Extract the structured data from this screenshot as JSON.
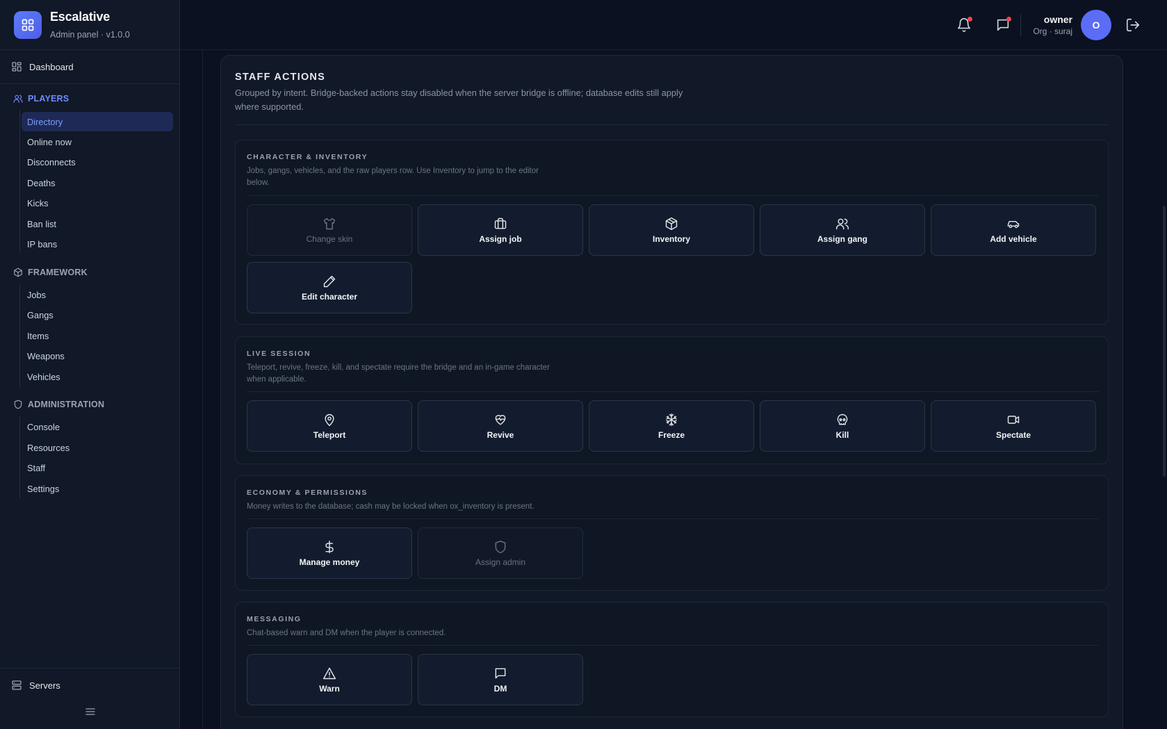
{
  "app": {
    "name": "Escalative",
    "subtitle": "Admin panel · v1.0.0"
  },
  "sidebar": {
    "dashboard": "Dashboard",
    "sections": [
      {
        "title": "PLAYERS",
        "items": [
          "Directory",
          "Online now",
          "Disconnects",
          "Deaths",
          "Kicks",
          "Ban list",
          "IP bans"
        ]
      },
      {
        "title": "FRAMEWORK",
        "items": [
          "Jobs",
          "Gangs",
          "Items",
          "Weapons",
          "Vehicles"
        ]
      },
      {
        "title": "ADMINISTRATION",
        "items": [
          "Console",
          "Resources",
          "Staff",
          "Settings"
        ]
      }
    ],
    "active_item": "Directory",
    "servers": "Servers"
  },
  "topbar": {
    "user_name": "owner",
    "user_org": "Org · suraj",
    "avatar_initial": "O"
  },
  "panel": {
    "title": "STAFF ACTIONS",
    "description": "Grouped by intent. Bridge-backed actions stay disabled when the server bridge is offline; database edits still apply where supported.",
    "groups": [
      {
        "title": "CHARACTER & INVENTORY",
        "description": "Jobs, gangs, vehicles, and the raw players row. Use Inventory to jump to the editor below.",
        "actions": [
          {
            "label": "Change skin",
            "icon": "shirt-icon",
            "disabled": true
          },
          {
            "label": "Assign job",
            "icon": "briefcase-icon",
            "disabled": false
          },
          {
            "label": "Inventory",
            "icon": "package-icon",
            "disabled": false
          },
          {
            "label": "Assign gang",
            "icon": "users-icon",
            "disabled": false
          },
          {
            "label": "Add vehicle",
            "icon": "car-icon",
            "disabled": false
          },
          {
            "label": "Edit character",
            "icon": "pencil-icon",
            "disabled": false
          }
        ]
      },
      {
        "title": "LIVE SESSION",
        "description": "Teleport, revive, freeze, kill, and spectate require the bridge and an in-game character when applicable.",
        "actions": [
          {
            "label": "Teleport",
            "icon": "map-pin-icon",
            "disabled": false
          },
          {
            "label": "Revive",
            "icon": "heart-pulse-icon",
            "disabled": false
          },
          {
            "label": "Freeze",
            "icon": "snowflake-icon",
            "disabled": false
          },
          {
            "label": "Kill",
            "icon": "skull-icon",
            "disabled": false
          },
          {
            "label": "Spectate",
            "icon": "video-icon",
            "disabled": false
          }
        ]
      },
      {
        "title": "ECONOMY & PERMISSIONS",
        "description": "Money writes to the database; cash may be locked when ox_inventory is present.",
        "actions": [
          {
            "label": "Manage money",
            "icon": "dollar-icon",
            "disabled": false
          },
          {
            "label": "Assign admin",
            "icon": "shield-icon",
            "disabled": true
          }
        ]
      },
      {
        "title": "MESSAGING",
        "description": "Chat-based warn and DM when the player is connected.",
        "actions": [
          {
            "label": "Warn",
            "icon": "alert-triangle-icon",
            "disabled": false
          },
          {
            "label": "DM",
            "icon": "message-icon",
            "disabled": false
          }
        ]
      }
    ]
  },
  "colors": {
    "accent": "#5b6cf6",
    "badge": "#ef4444",
    "background": "#0b1120"
  }
}
